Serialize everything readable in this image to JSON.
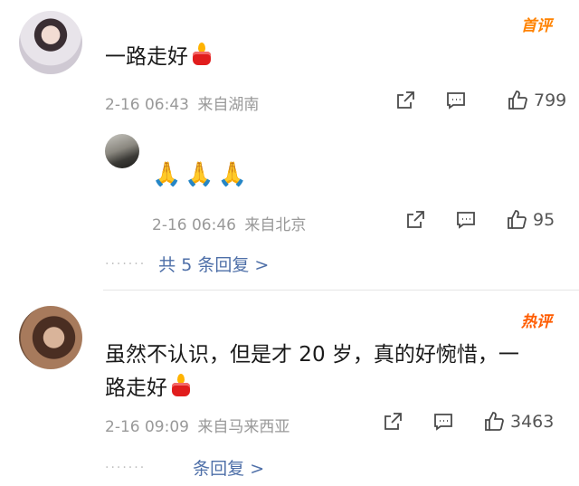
{
  "comments": [
    {
      "badge": "首评",
      "text": "一路走好",
      "timestamp": "2-16 06:43",
      "location": "来自湖南",
      "likes": "799"
    },
    {
      "badge": "热评",
      "text_line1": "虽然不认识，但是才 20 岁，真的好惋惜，一",
      "text_line2": "路走好",
      "timestamp": "2-16 09:09",
      "location": "来自马来西亚",
      "likes": "3463",
      "more_replies": "条回复 >"
    }
  ],
  "reply": {
    "text": "🙏🙏🙏",
    "timestamp": "2-16 06:46",
    "location": "来自北京",
    "likes": "95"
  },
  "more_replies_1": "共 5 条回复 >",
  "dots": "·······",
  "icons": [
    "share-icon",
    "comment-icon",
    "like-icon",
    "candle-icon"
  ],
  "colors": {
    "badge_first": "#ff8200",
    "badge_hot": "#ff5c00",
    "link": "#4e6fa8",
    "meta": "#999999"
  }
}
